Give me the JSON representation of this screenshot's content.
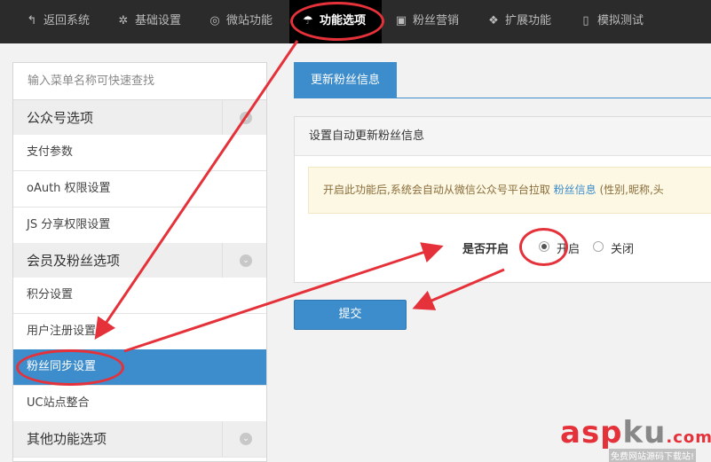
{
  "topnav": {
    "items": [
      {
        "label": "返回系统",
        "icon": "reply-icon",
        "glyph": "↰"
      },
      {
        "label": "基础设置",
        "icon": "gear-icon",
        "glyph": "✲"
      },
      {
        "label": "微站功能",
        "icon": "lifebuoy-icon",
        "glyph": "◎"
      },
      {
        "label": "功能选项",
        "icon": "umbrella-icon",
        "glyph": "☂"
      },
      {
        "label": "粉丝营销",
        "icon": "gift-icon",
        "glyph": "▣"
      },
      {
        "label": "扩展功能",
        "icon": "cubes-icon",
        "glyph": "❖"
      },
      {
        "label": "模拟测试",
        "icon": "mobile-icon",
        "glyph": "▯"
      }
    ],
    "active_index": 3
  },
  "sidebar": {
    "search_placeholder": "输入菜单名称可快速查找",
    "rows": [
      {
        "label": "公众号选项",
        "type": "group"
      },
      {
        "label": "支付参数",
        "type": "item"
      },
      {
        "label": "oAuth 权限设置",
        "type": "item"
      },
      {
        "label": "JS 分享权限设置",
        "type": "item"
      },
      {
        "label": "会员及粉丝选项",
        "type": "group"
      },
      {
        "label": "积分设置",
        "type": "item"
      },
      {
        "label": "用户注册设置",
        "type": "item"
      },
      {
        "label": "粉丝同步设置",
        "type": "item",
        "active": true
      },
      {
        "label": "UC站点整合",
        "type": "item"
      },
      {
        "label": "其他功能选项",
        "type": "group"
      }
    ]
  },
  "main": {
    "tab_label": "更新粉丝信息",
    "panel_title": "设置自动更新粉丝信息",
    "alert_prefix": "开启此功能后,系统会自动从微信公众号平台拉取",
    "alert_link": "粉丝信息",
    "alert_suffix": "(性别,昵称,头",
    "field_label": "是否开启",
    "radio_on_label": "开启",
    "radio_off_label": "关闭",
    "selected": "开启",
    "submit_label": "提交"
  },
  "watermark": {
    "brand_a": "asp",
    "brand_b": "ku",
    "brand_c": ".com",
    "tagline": "免费网站源码下载站!"
  },
  "colors": {
    "accent": "#3d8ccb",
    "annotation": "#e5323a",
    "nav_bg": "#2b2b2b"
  }
}
